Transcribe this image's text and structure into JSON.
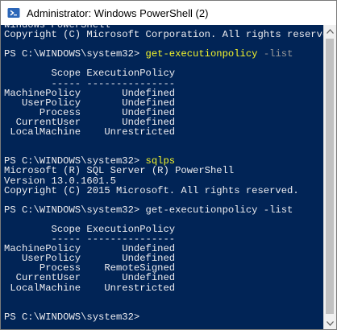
{
  "window": {
    "title": "Administrator: Windows PowerShell (2)",
    "background_color": "#012456",
    "text_color": "#EEEDF0",
    "command_color": "#F5F52B"
  },
  "titlebar": {
    "icon": "powershell-icon"
  },
  "scrollbar": {
    "up_icon": "scroll-up-arrow-icon",
    "down_icon": "scroll-down-arrow-icon"
  },
  "console": {
    "lines": [
      {
        "segments": [
          {
            "text": "Windows PowerShell"
          }
        ]
      },
      {
        "segments": [
          {
            "text": "Copyright (C) Microsoft Corporation. All rights reserved."
          }
        ]
      },
      {
        "segments": [
          {
            "text": ""
          }
        ]
      },
      {
        "segments": [
          {
            "text": "PS C:\\WINDOWS\\system32> "
          },
          {
            "text": "get-executionpolicy",
            "style": "cmd"
          },
          {
            "text": " -list",
            "style": "param"
          }
        ]
      },
      {
        "segments": [
          {
            "text": ""
          }
        ]
      },
      {
        "segments": [
          {
            "text": "        Scope ExecutionPolicy"
          }
        ]
      },
      {
        "segments": [
          {
            "text": "        ----- ---------------"
          }
        ]
      },
      {
        "segments": [
          {
            "text": "MachinePolicy       Undefined"
          }
        ]
      },
      {
        "segments": [
          {
            "text": "   UserPolicy       Undefined"
          }
        ]
      },
      {
        "segments": [
          {
            "text": "      Process       Undefined"
          }
        ]
      },
      {
        "segments": [
          {
            "text": "  CurrentUser       Undefined"
          }
        ]
      },
      {
        "segments": [
          {
            "text": " LocalMachine    Unrestricted"
          }
        ]
      },
      {
        "segments": [
          {
            "text": ""
          }
        ]
      },
      {
        "segments": [
          {
            "text": ""
          }
        ]
      },
      {
        "segments": [
          {
            "text": "PS C:\\WINDOWS\\system32> "
          },
          {
            "text": "sqlps",
            "style": "cmd"
          }
        ]
      },
      {
        "segments": [
          {
            "text": "Microsoft (R) SQL Server (R) PowerShell"
          }
        ]
      },
      {
        "segments": [
          {
            "text": "Version 13.0.1601.5"
          }
        ]
      },
      {
        "segments": [
          {
            "text": "Copyright (C) 2015 Microsoft. All rights reserved."
          }
        ]
      },
      {
        "segments": [
          {
            "text": ""
          }
        ]
      },
      {
        "segments": [
          {
            "text": "PS C:\\WINDOWS\\system32> get-executionpolicy -list"
          }
        ]
      },
      {
        "segments": [
          {
            "text": ""
          }
        ]
      },
      {
        "segments": [
          {
            "text": "        Scope ExecutionPolicy"
          }
        ]
      },
      {
        "segments": [
          {
            "text": "        ----- ---------------"
          }
        ]
      },
      {
        "segments": [
          {
            "text": "MachinePolicy       Undefined"
          }
        ]
      },
      {
        "segments": [
          {
            "text": "   UserPolicy       Undefined"
          }
        ]
      },
      {
        "segments": [
          {
            "text": "      Process    RemoteSigned"
          }
        ]
      },
      {
        "segments": [
          {
            "text": "  CurrentUser       Undefined"
          }
        ]
      },
      {
        "segments": [
          {
            "text": " LocalMachine    Unrestricted"
          }
        ]
      },
      {
        "segments": [
          {
            "text": ""
          }
        ]
      },
      {
        "segments": [
          {
            "text": ""
          }
        ]
      },
      {
        "segments": [
          {
            "text": "PS C:\\WINDOWS\\system32>"
          }
        ]
      }
    ]
  }
}
